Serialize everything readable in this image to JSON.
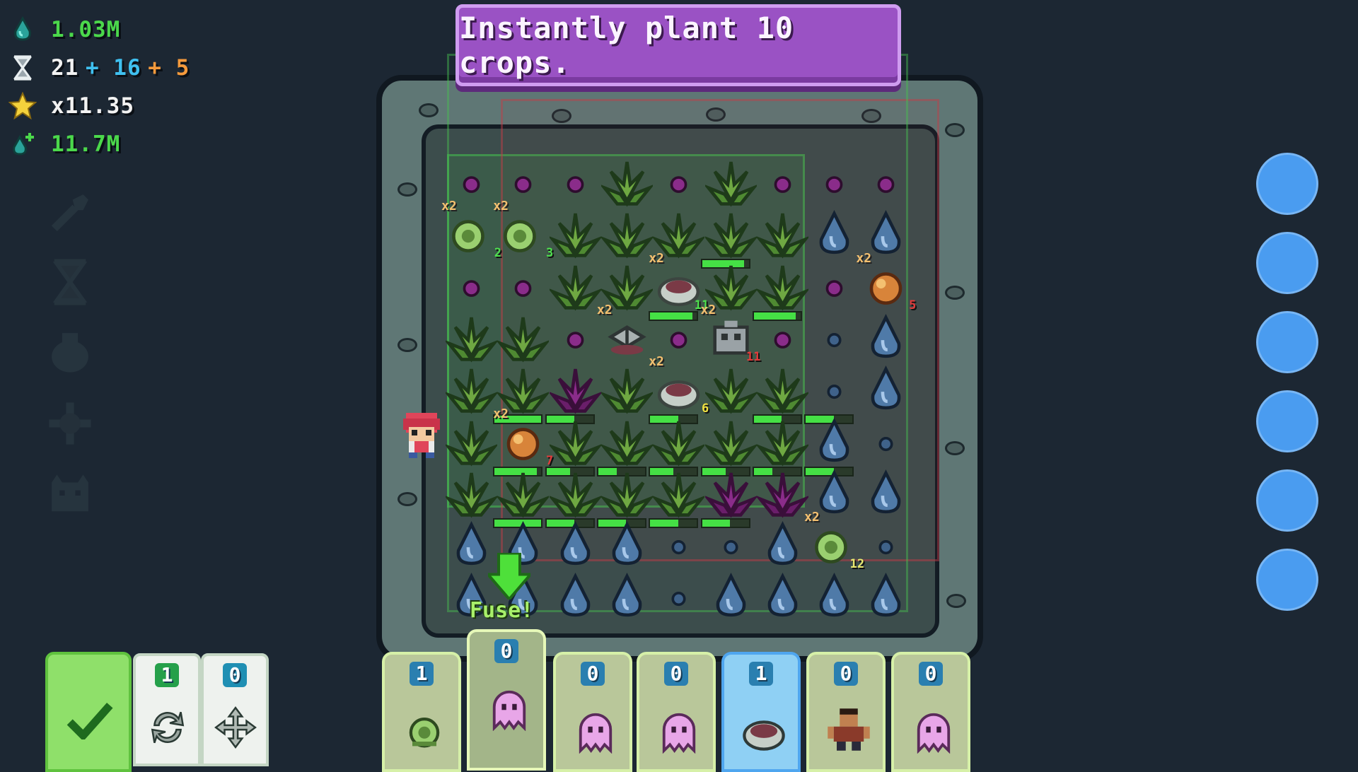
{
  "stats": {
    "water": "1.03M",
    "time_base": "21",
    "time_plus1": "+ 16",
    "time_plus2": "+ 5",
    "multiplier": "x11.35",
    "water_rate": "11.7M"
  },
  "banner": {
    "text": "Instantly plant 10 crops."
  },
  "fuse": {
    "label": "Fuse!"
  },
  "left_tools": [
    "shovel-icon",
    "hourglass-icon",
    "seed-bag-icon",
    "crosshair-icon",
    "monster-icon"
  ],
  "confirm_deck": {
    "confirm_label": "confirm",
    "reroll_count": "1",
    "move_count": "0"
  },
  "hand_cards": [
    {
      "count": "1",
      "art": "sprout-icon"
    },
    {
      "count": "0",
      "art": "pink-ghost-icon"
    },
    {
      "count": "0",
      "art": "pink-ghost-icon"
    },
    {
      "count": "0",
      "art": "pink-ghost-icon"
    },
    {
      "count": "1",
      "art": "stone-sack-icon"
    },
    {
      "count": "0",
      "art": "brawler-icon"
    },
    {
      "count": "0",
      "art": "pink-ghost-icon"
    }
  ],
  "grid_bonuses": {
    "bonus_text": "x2",
    "b1_count": "2",
    "b2_count": "3",
    "b3_count": "11",
    "b4_count": "5",
    "b5_count": "11",
    "b6_count": "6",
    "b7_count": "7",
    "b8_count": "12"
  },
  "colors": {
    "background": "#1c2733",
    "banner": "#9a52c4",
    "hp_bar": "#45e045",
    "card": "#b9c79a",
    "selected_card": "#8fd0f4",
    "circle_button": "#4a9cf0"
  },
  "crop_health": {
    "r1c5": 0.9,
    "r2c4": 0.9,
    "r2c6": 0.9,
    "r4c1": 1.0,
    "r4c2": 0.6,
    "r4c4": 0.6,
    "r4c6": 0.6,
    "r4c7": 0.6,
    "r5c1": 0.9,
    "r5c2": 0.5,
    "r5c3": 0.4,
    "r5c4": 0.5,
    "r5c5": 0.5,
    "r5c6": 0.4,
    "r5c7": 0.6,
    "r6c1": 1.0,
    "r6c2": 0.6,
    "r6c3": 0.6,
    "r6c4": 0.6,
    "r6c5": 0.6
  }
}
